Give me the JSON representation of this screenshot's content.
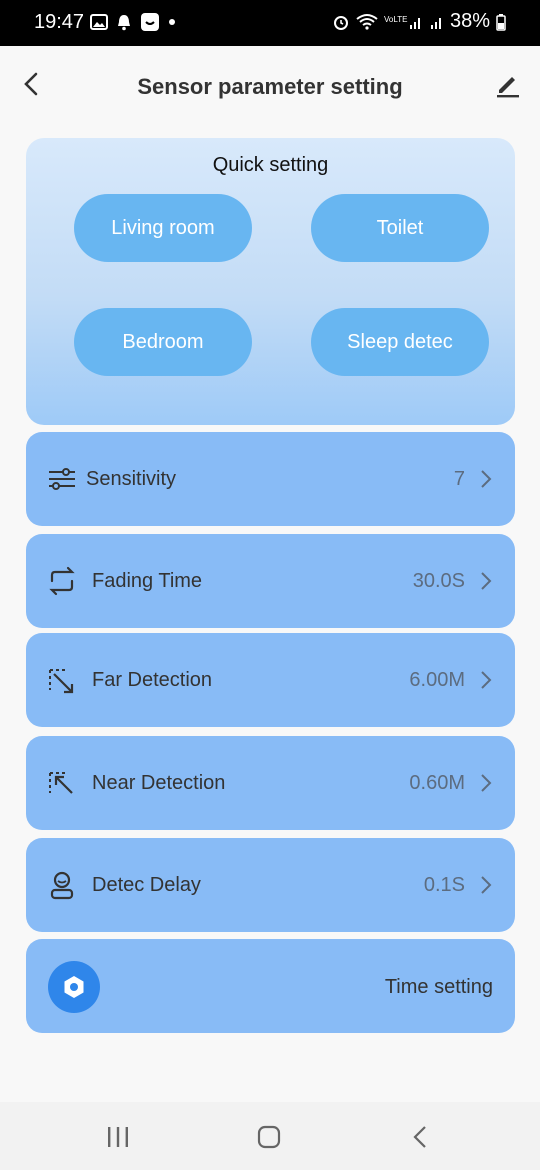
{
  "status_bar": {
    "time": "19:47",
    "battery": "38%"
  },
  "header": {
    "title": "Sensor parameter setting"
  },
  "quick_setting": {
    "title": "Quick setting",
    "buttons": [
      "Living room",
      "Toilet",
      "Bedroom",
      "Sleep detec"
    ]
  },
  "settings": [
    {
      "label": "Sensitivity",
      "value": "7",
      "icon": "sliders-icon"
    },
    {
      "label": "Fading Time",
      "value": "30.0S",
      "icon": "repeat-icon"
    },
    {
      "label": "Far Detection",
      "value": "6.00M",
      "icon": "far-detection-icon"
    },
    {
      "label": "Near Detection",
      "value": "0.60M",
      "icon": "near-detection-icon"
    },
    {
      "label": "Detec Delay",
      "value": "0.1S",
      "icon": "person-icon"
    }
  ],
  "time_setting": {
    "label": "Time setting",
    "icon": "hexagon-nut-icon"
  },
  "colors": {
    "accent": "#2f86ea",
    "row_bg": "#88bbf6",
    "quick_button": "#68b6f1"
  }
}
